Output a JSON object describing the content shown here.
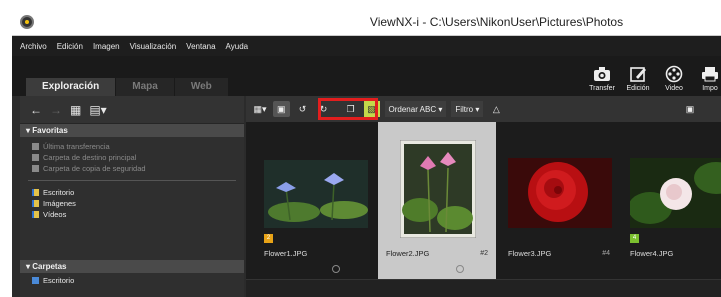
{
  "window": {
    "title": "ViewNX-i - C:\\Users\\NikonUser\\Pictures\\Photos"
  },
  "menu": [
    "Archivo",
    "Edición",
    "Imagen",
    "Visualización",
    "Ventana",
    "Ayuda"
  ],
  "tabs": [
    {
      "label": "Exploración",
      "active": true
    },
    {
      "label": "Mapa",
      "active": false
    },
    {
      "label": "Web",
      "active": false
    }
  ],
  "tools": [
    {
      "label": "Transfer",
      "icon": "camera-icon"
    },
    {
      "label": "Edición",
      "icon": "edit-icon"
    },
    {
      "label": "Video",
      "icon": "film-reel-icon"
    },
    {
      "label": "Impo",
      "icon": "printer-icon"
    }
  ],
  "left_panel": {
    "favorites": {
      "title": "Favoritas",
      "items": [
        {
          "label": "Última transferencia",
          "dim": true
        },
        {
          "label": "Carpeta de destino principal",
          "dim": true
        },
        {
          "label": "Carpeta de copia de seguridad",
          "dim": true
        }
      ],
      "places": [
        {
          "label": "Escritorio"
        },
        {
          "label": "Imágenes"
        },
        {
          "label": "Vídeos"
        }
      ]
    },
    "folders": {
      "title": "Carpetas",
      "items": [
        {
          "label": "Escritorio"
        }
      ]
    }
  },
  "toolbar": {
    "sort_label": "Ordenar ABC",
    "filter_label": "Filtro"
  },
  "thumbnails": [
    {
      "filename": "Flower1.JPG",
      "number": "",
      "badge": "2",
      "badge_color": "#e8a317",
      "selected": false
    },
    {
      "filename": "Flower2.JPG",
      "number": "#2",
      "badge": "",
      "badge_color": "",
      "selected": true
    },
    {
      "filename": "Flower3.JPG",
      "number": "#4",
      "badge": "",
      "badge_color": "",
      "selected": false
    },
    {
      "filename": "Flower4.JPG",
      "number": "#3",
      "badge": "4",
      "badge_color": "#7bbf2f",
      "selected": false
    }
  ],
  "colors": {
    "highlight": "#e21e1e",
    "accent_green": "#c4d84a"
  }
}
